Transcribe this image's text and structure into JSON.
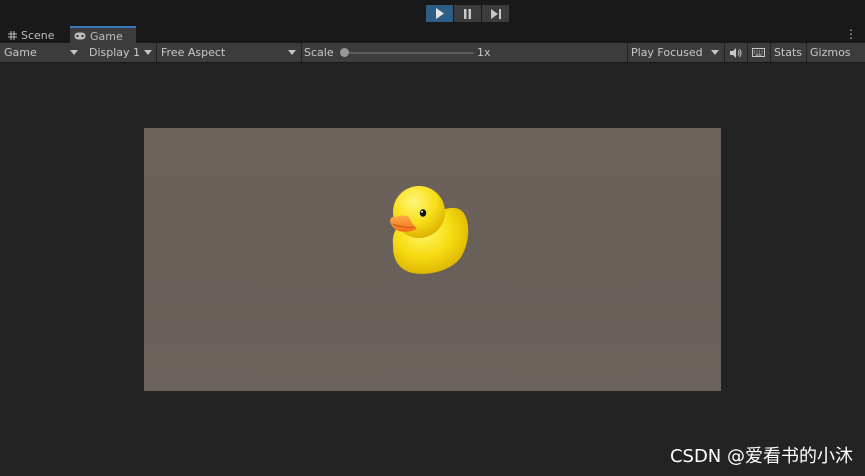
{
  "play_controls": {
    "play": "play-icon",
    "pause": "pause-icon",
    "step": "step-icon"
  },
  "tabs": [
    {
      "label": "Scene",
      "icon": "scene-grid-icon"
    },
    {
      "label": "Game",
      "icon": "gamepad-icon",
      "active": true
    }
  ],
  "toolbar": {
    "view_mode": "Game",
    "display": "Display 1",
    "aspect": "Free Aspect",
    "scale_label": "Scale",
    "scale_value": "1x",
    "play_mode": "Play Focused",
    "mute_icon": "speaker-icon",
    "keyboard_icon": "keyboard-icon",
    "stats_label": "Stats",
    "gizmos_label": "Gizmos"
  },
  "game_view": {
    "object": "rubber-duck",
    "background_color": "#6b615b"
  },
  "watermark": "CSDN @爱看书的小沐",
  "colors": {
    "accent": "#3a79bb",
    "play_active": "#2c5d87"
  }
}
